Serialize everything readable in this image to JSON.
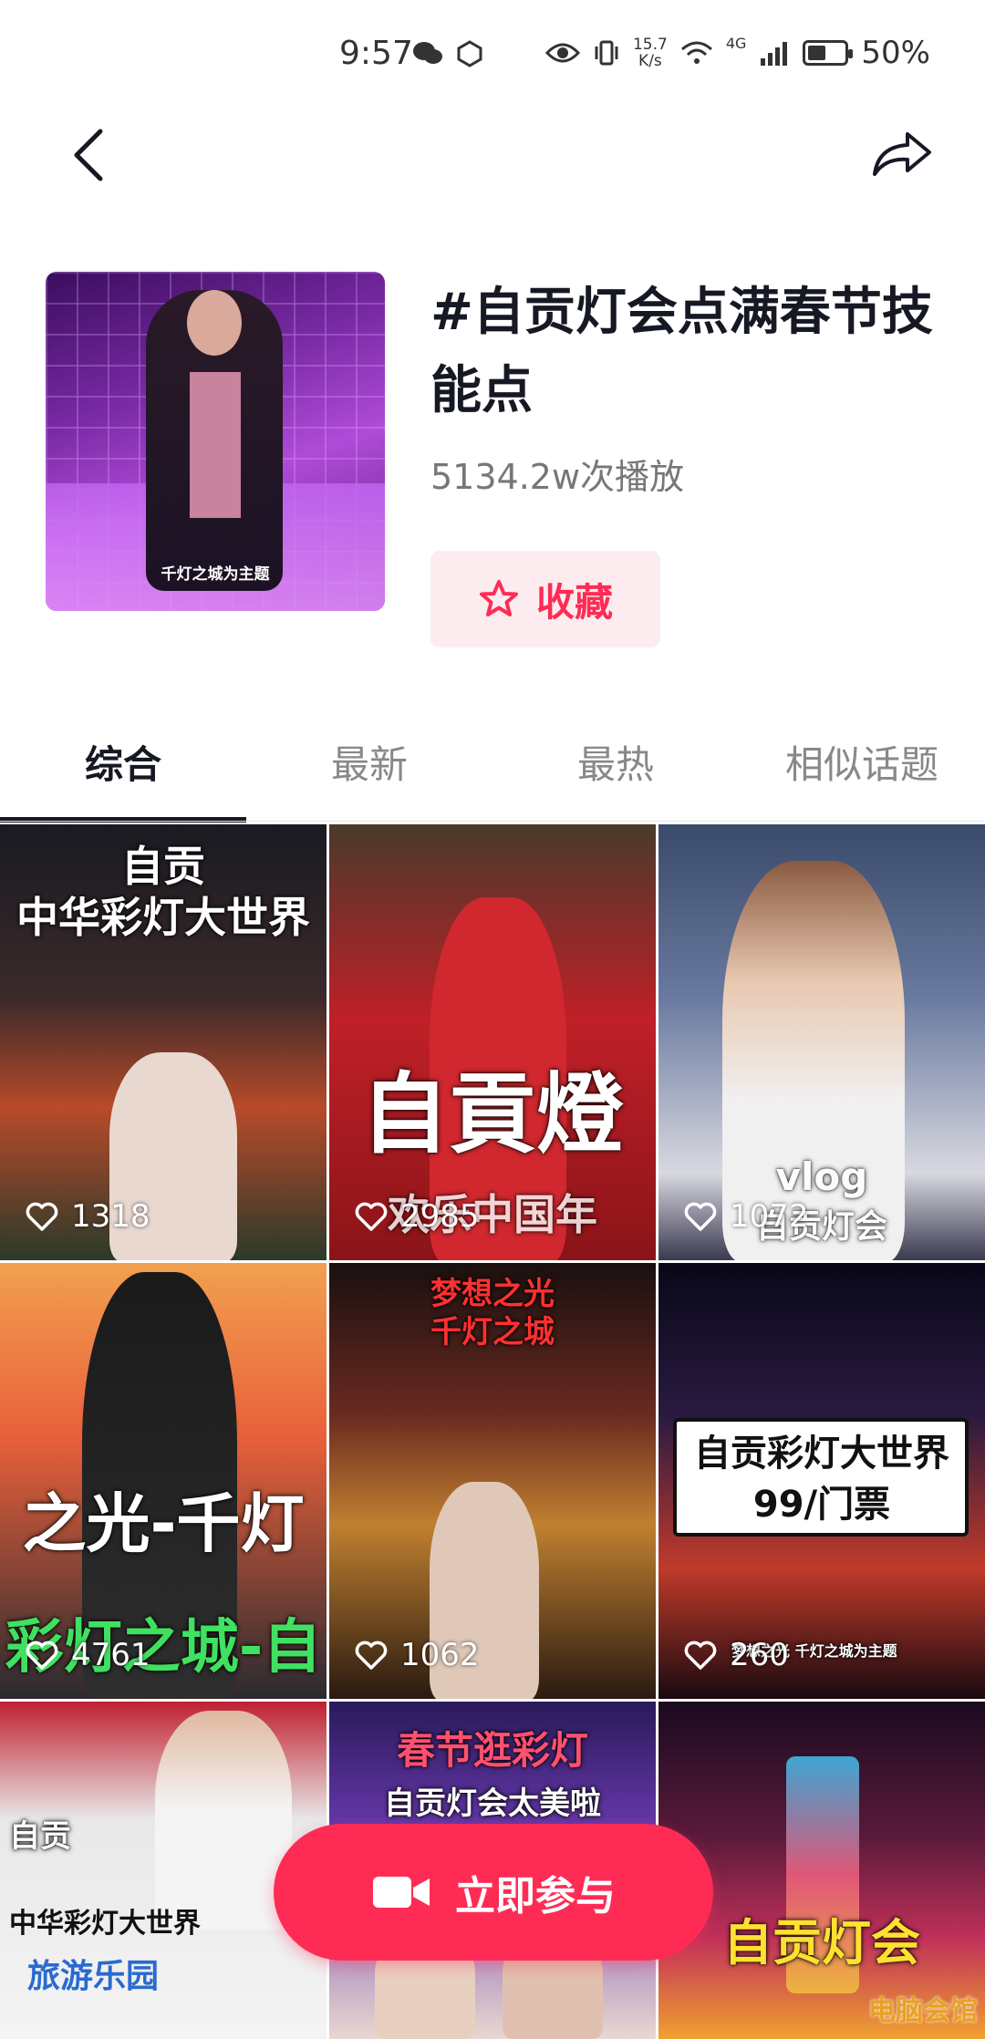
{
  "status": {
    "time": "9:57",
    "net_speed_value": "15.7",
    "net_speed_unit": "K/s",
    "network": "4G",
    "battery": "50%",
    "battery_level": 0.5
  },
  "nav": {
    "back_icon": "chevron-left-icon",
    "share_icon": "share-arrow-icon"
  },
  "topic": {
    "cover_caption": "千灯之城为主题",
    "title": "#自贡灯会点满春节技能点",
    "play_count": "5134.2w次播放",
    "favorite_label": "收藏"
  },
  "tabs": [
    {
      "label": "综合",
      "active": true
    },
    {
      "label": "最新",
      "active": false
    },
    {
      "label": "最热",
      "active": false
    },
    {
      "label": "相似话题",
      "active": false
    }
  ],
  "videos": [
    {
      "likes": "1318",
      "overlay_line1": "自贡",
      "overlay_line2": "中华彩灯大世界"
    },
    {
      "likes": "2985",
      "overlay_line1": "自貢燈",
      "overlay_line2": "欢乐中国年"
    },
    {
      "likes": "1072",
      "overlay_line1": "vlog",
      "overlay_line2": "自贡灯会"
    },
    {
      "likes": "4761",
      "overlay_line1": "之光-千灯",
      "overlay_line2": "彩灯之城-自贡"
    },
    {
      "likes": "1062",
      "overlay_line1": "梦想之光",
      "overlay_line2": "千灯之城"
    },
    {
      "likes": "260",
      "overlay_line1": "自贡彩灯大世界",
      "overlay_line2": "99/门票",
      "caption": "梦想之光 千灯之城为主题"
    },
    {
      "likes": "",
      "overlay_line1": "自贡",
      "overlay_line2": "中华彩灯大世界",
      "overlay_line3": "旅游乐园"
    },
    {
      "likes": "",
      "overlay_line1": "春节逛彩灯",
      "overlay_line2": "自贡灯会太美啦"
    },
    {
      "likes": "",
      "overlay_line1": "自贡灯会",
      "overlay_line2": ""
    }
  ],
  "join_button": {
    "label": "立即参与",
    "icon": "video-camera-icon"
  },
  "watermark": "电脑会馆",
  "colors": {
    "accent": "#fe2c55",
    "favorite_bg": "#fdecef"
  }
}
